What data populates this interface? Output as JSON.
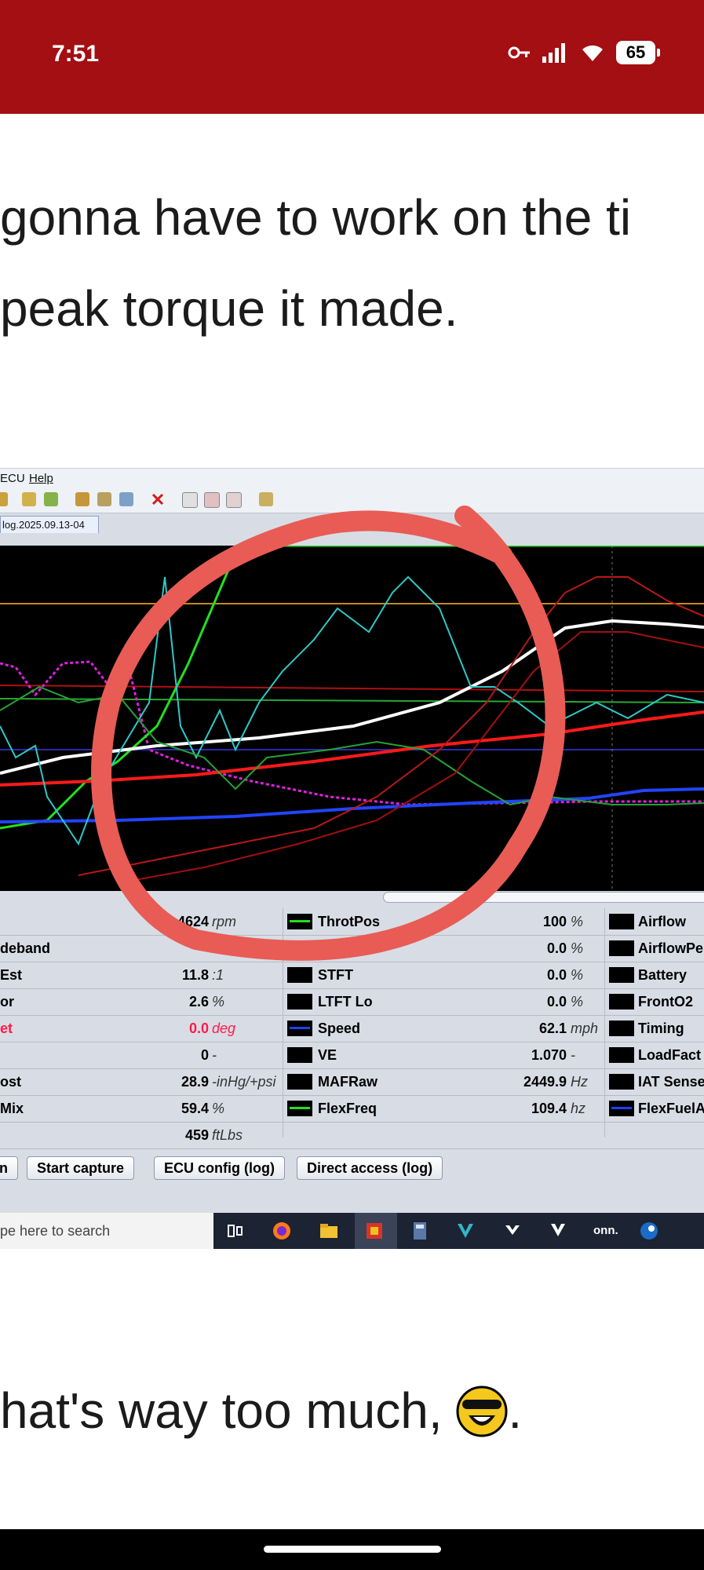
{
  "status": {
    "time": "7:51",
    "battery": "65"
  },
  "post": {
    "line1": "gonna have to work on the ti",
    "line2": "peak torque it made.",
    "line3": "hat's way too much,",
    "line3_end": "."
  },
  "app": {
    "menu": {
      "ecu": "ECU",
      "help": "Help"
    },
    "tab": "log.2025.09.13-04",
    "params_left": [
      {
        "name": "",
        "value": "4624",
        "unit": "rpm"
      },
      {
        "name": "deband",
        "value": "",
        "unit": ""
      },
      {
        "name": "Est",
        "value": "11.8",
        "unit": ":1"
      },
      {
        "name": "or",
        "value": "2.6",
        "unit": "%"
      },
      {
        "name": "et",
        "value": "0.0",
        "unit": "deg",
        "color": "#ff1a4a"
      },
      {
        "name": "",
        "value": "0",
        "unit": "-"
      },
      {
        "name": "ost",
        "value": "28.9",
        "unit": "-inHg/+psi"
      },
      {
        "name": "Mix",
        "value": "59.4",
        "unit": "%"
      },
      {
        "name": "",
        "value": "459",
        "unit": "ftLbs"
      }
    ],
    "params_mid": [
      {
        "name": "ThrotPos",
        "value": "100",
        "unit": "%",
        "color": "#22e022"
      },
      {
        "name": "",
        "value": "0.0",
        "unit": "%",
        "color": "#000000"
      },
      {
        "name": "STFT",
        "value": "0.0",
        "unit": "%",
        "color": "#000000"
      },
      {
        "name": "LTFT Lo",
        "value": "0.0",
        "unit": "%",
        "color": "#000000"
      },
      {
        "name": "Speed",
        "value": "62.1",
        "unit": "mph",
        "color": "#1f3fff"
      },
      {
        "name": "VE",
        "value": "1.070",
        "unit": "-",
        "color": "#000000"
      },
      {
        "name": "MAFRaw",
        "value": "2449.9",
        "unit": "Hz",
        "color": "#000000"
      },
      {
        "name": "FlexFreq",
        "value": "109.4",
        "unit": "hz",
        "color": "#22e022"
      }
    ],
    "params_right": [
      {
        "name": "Airflow",
        "color": "#000000"
      },
      {
        "name": "AirflowPe",
        "color": "#000000"
      },
      {
        "name": "Battery",
        "color": "#000000"
      },
      {
        "name": "FrontO2",
        "color": "#000000"
      },
      {
        "name": "Timing",
        "color": "#000000"
      },
      {
        "name": "LoadFact",
        "color": "#000000"
      },
      {
        "name": "IAT Sense",
        "color": "#000000"
      },
      {
        "name": "FlexFuelA",
        "color": "#1f3fff"
      }
    ],
    "buttons": {
      "n": "n",
      "start_capture": "Start capture",
      "ecu_config": "ECU config (log)",
      "direct_access": "Direct access (log)"
    },
    "taskbar": {
      "search_placeholder": "pe here to search",
      "onn": "onn."
    }
  }
}
